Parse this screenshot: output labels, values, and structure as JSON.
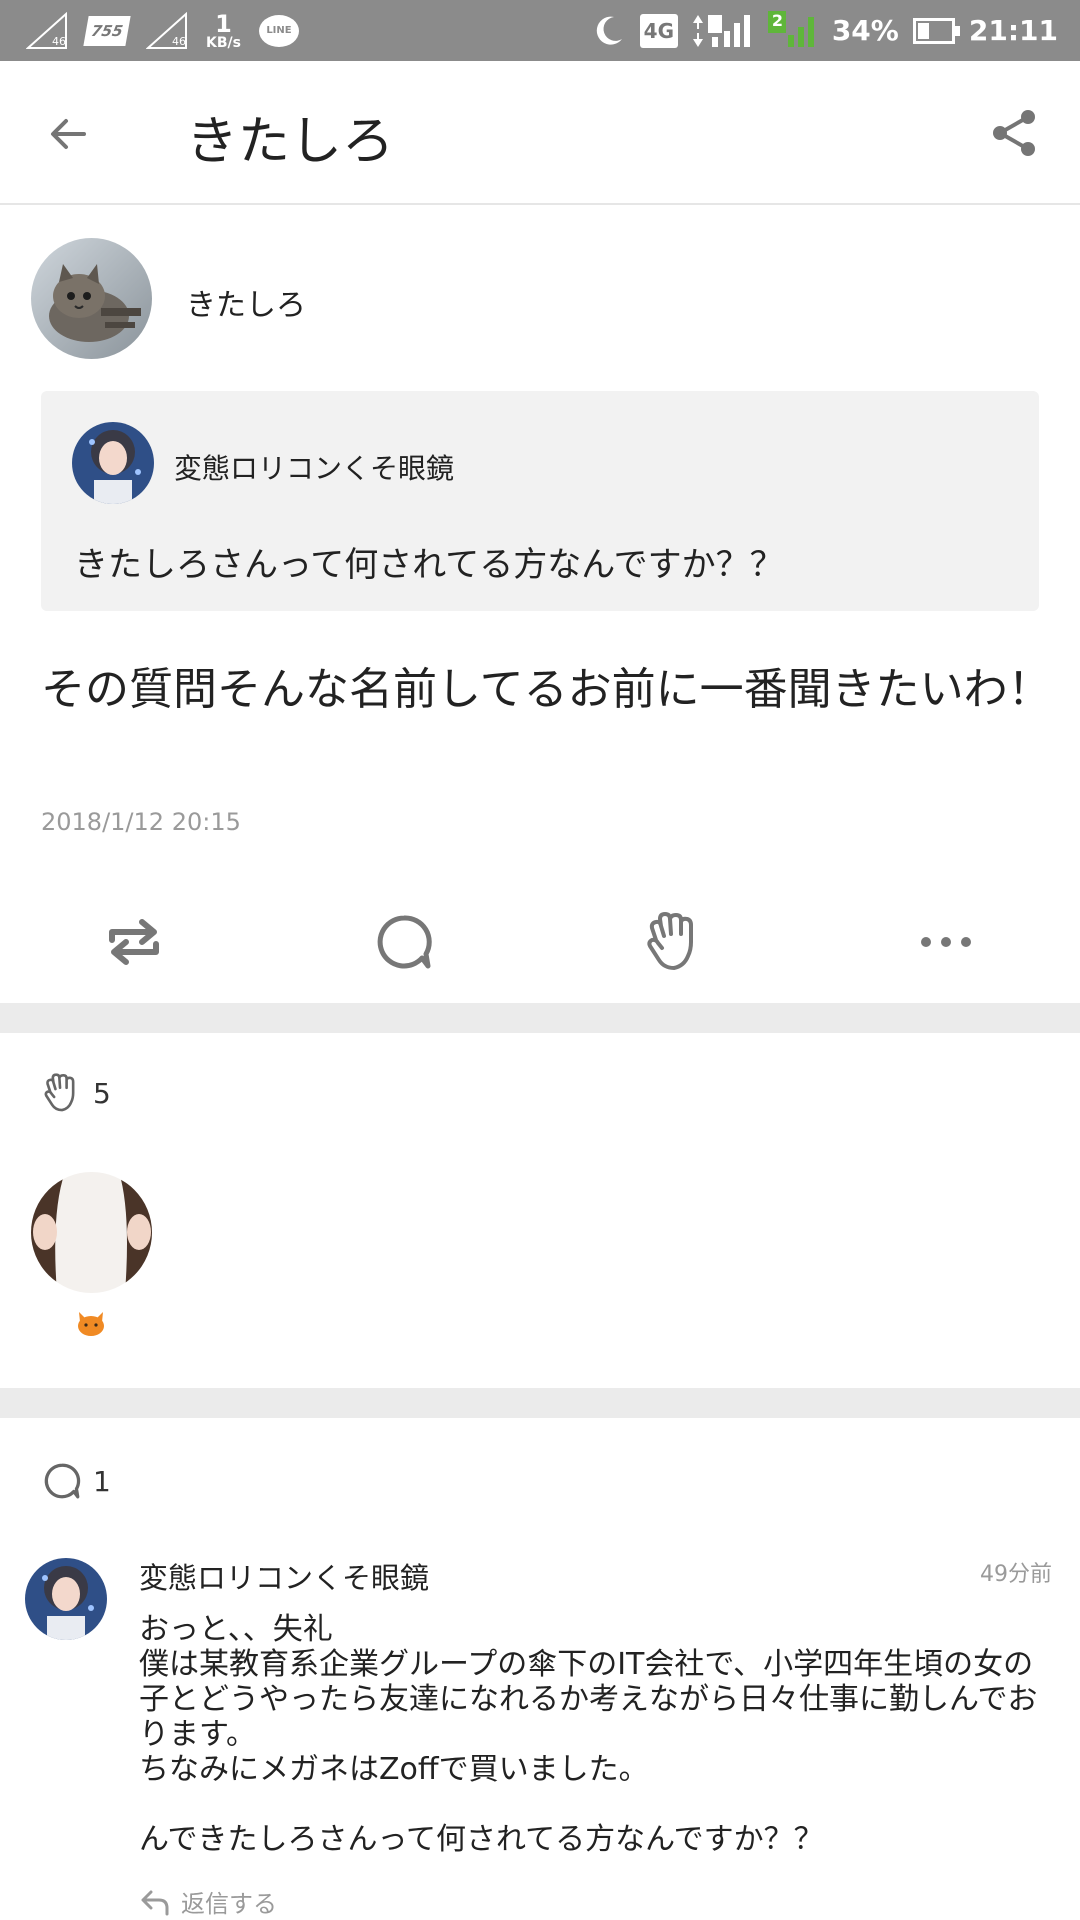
{
  "status_bar": {
    "signal1_label": "46",
    "app_badge": "755",
    "signal2_label": "46",
    "speed_value": "1",
    "speed_unit": "KB/s",
    "line_icon_text": "LINE",
    "network_badge": "4G",
    "sim2_badge": "2",
    "battery_percent": "34%",
    "battery_level": 0.34,
    "time": "21:11"
  },
  "header": {
    "title": "きたしろ"
  },
  "post": {
    "author": "きたしろ",
    "quoted": {
      "author": "変態ロリコンくそ眼鏡",
      "text": "きたしろさんって何されてる方なんですか？？"
    },
    "text": "その質問そんな名前してるお前に一番聞きたいわ！",
    "date": "2018/1/12 20:15"
  },
  "actions": [
    "repost-icon",
    "comment-icon",
    "clap-icon",
    "more-icon"
  ],
  "likes": {
    "count": "5"
  },
  "comments": {
    "count": "1",
    "items": [
      {
        "author": "変態ロリコンくそ眼鏡",
        "time": "49分前",
        "body": "おっと、、失礼\n僕は某教育系企業グループの傘下のIT会社で、小学四年生頃の女の子とどうやったら友達になれるか考えながら日々仕事に勤しんでおります。\nちなみにメガネはZoffで買いました。\n\nんできたしろさんって何されてる方なんですか？？",
        "reply_label": "返信する"
      }
    ]
  },
  "colors": {
    "status_bar_bg": "#8b8b8b",
    "quote_bg": "#f2f2f2",
    "separator": "#ebebeb",
    "muted_text": "#9a9a9a",
    "signal_green": "#5fb63a"
  }
}
